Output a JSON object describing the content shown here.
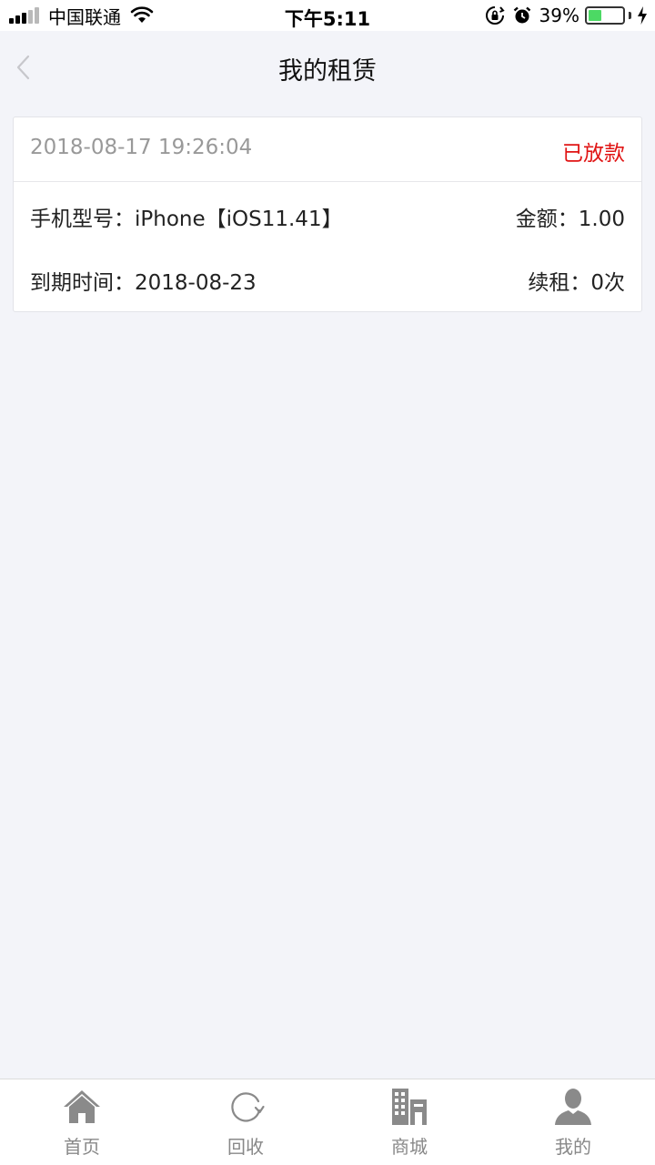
{
  "status_bar": {
    "carrier": "中国联通",
    "time": "下午5:11",
    "battery_percent": "39%",
    "battery_level": 0.39,
    "icons": [
      "signal-icon",
      "wifi-icon",
      "orientation-lock-icon",
      "alarm-icon",
      "battery-icon",
      "charging-icon"
    ]
  },
  "nav": {
    "title": "我的租赁",
    "back_icon": "chevron-left-icon"
  },
  "rental": {
    "datetime": "2018-08-17 19:26:04",
    "status": "已放款",
    "status_color": "#e01414",
    "model_label": "手机型号：iPhone【iOS11.41】",
    "amount_label": "金额：1.00",
    "expire_label": "到期时间：2018-08-23",
    "renew_label": "续租：0次"
  },
  "tabs": [
    {
      "label": "首页",
      "icon": "home-icon"
    },
    {
      "label": "回收",
      "icon": "refresh-icon"
    },
    {
      "label": "商城",
      "icon": "building-icon"
    },
    {
      "label": "我的",
      "icon": "user-icon"
    }
  ],
  "colors": {
    "background": "#f3f4f9",
    "tab_icon": "#8a8a8a",
    "tab_label": "#888888"
  }
}
